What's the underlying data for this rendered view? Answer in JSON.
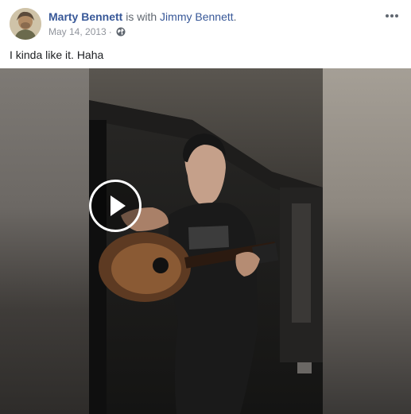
{
  "post": {
    "author": "Marty Bennett",
    "with_text": " is with ",
    "with_name": "Jimmy Bennett",
    "with_suffix": ".",
    "date": "May 14, 2013",
    "separator": "·",
    "privacy_icon": "globe-icon",
    "more_icon": "more-options-icon",
    "caption": "I kinda like it. Haha"
  },
  "video": {
    "play_icon": "play-icon"
  },
  "colors": {
    "link": "#385898",
    "meta": "#90949c",
    "text": "#1c1e21"
  }
}
